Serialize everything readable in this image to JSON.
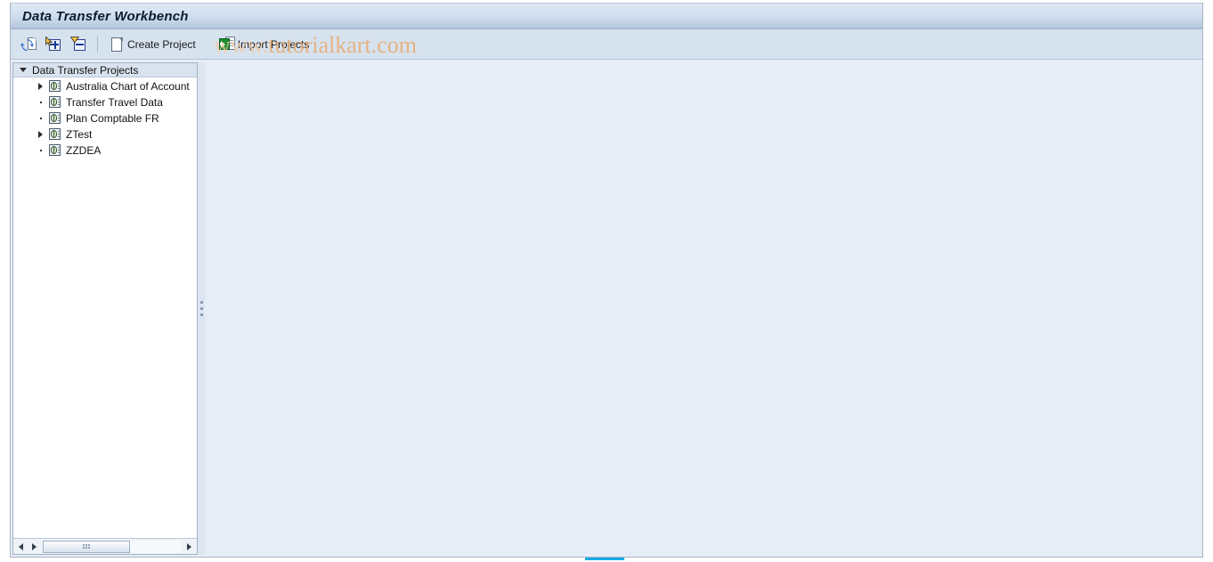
{
  "window": {
    "title": "Data Transfer Workbench"
  },
  "toolbar": {
    "items": [
      {
        "id": "refresh",
        "icon": "refresh-icon",
        "label": ""
      },
      {
        "id": "expand-all",
        "icon": "expand-all-icon",
        "label": ""
      },
      {
        "id": "collapse-all",
        "icon": "collapse-all-icon",
        "label": ""
      },
      {
        "id": "create-project",
        "icon": "new-document-icon",
        "label": "Create Project"
      },
      {
        "id": "import-projects",
        "icon": "import-icon",
        "label": "Import Projects"
      }
    ],
    "create_project_label": "Create Project",
    "import_projects_label": "Import Projects"
  },
  "watermark": {
    "prefix": "www.",
    "text": "tutorialkart.com",
    "color": "#e8a96a"
  },
  "tree": {
    "header": {
      "label": "Data Transfer Projects",
      "expanded": true,
      "toggle_icon": "caret-down-icon"
    },
    "nodes": [
      {
        "label": "Australia Chart of Account",
        "icon": "project-icon",
        "expandable": true,
        "toggle_icon": "caret-right-icon"
      },
      {
        "label": "Transfer Travel Data",
        "icon": "project-icon",
        "expandable": false,
        "toggle_icon": "leaf-dot-icon"
      },
      {
        "label": "Plan Comptable FR",
        "icon": "project-icon",
        "expandable": false,
        "toggle_icon": "leaf-dot-icon"
      },
      {
        "label": "ZTest",
        "icon": "project-icon",
        "expandable": true,
        "toggle_icon": "caret-right-icon"
      },
      {
        "label": "ZZDEA",
        "icon": "project-icon",
        "expandable": false,
        "toggle_icon": "leaf-dot-icon"
      }
    ],
    "scrollbar": {
      "left_arrow_icon": "arrow-left-icon",
      "right_arrow_icon": "arrow-right-icon",
      "far_right_arrow_icon": "arrow-right-icon",
      "thumb_grip_icon": "grip-dots-icon"
    }
  },
  "colors": {
    "title_bar_top": "#dfe9f4",
    "title_bar_bottom": "#a9bed6",
    "toolbar_bg": "#d7e2ef",
    "work_area_bg": "#e7edf6",
    "tree_bg": "#ffffff",
    "tree_header_bg": "#d9e3ef",
    "accent_bar": "#14aae4"
  }
}
